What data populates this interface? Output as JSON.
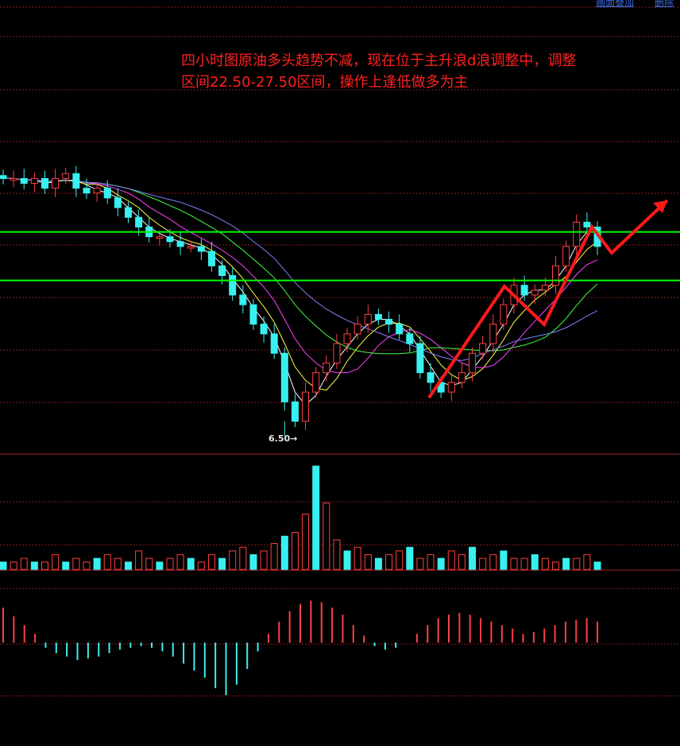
{
  "toolbar": {
    "link1": "画面叠加",
    "link2": "删除"
  },
  "annotation": {
    "text": "四小时图原油多头趋势不减，现在位于主升浪d浪调整中，调整区间22.50-27.50区间，操作上逢低做多为主"
  },
  "colors": {
    "background": "#000000",
    "grid": "#8b1a1a",
    "up_candle": "#ff4040",
    "down_candle": "#38f0f0",
    "support_lines": "#00ff00",
    "arrows": "#ff1a1a",
    "ma5": "#ffffff",
    "ma10": "#ffff40",
    "ma20": "#ff40ff",
    "ma40": "#40ff40",
    "ma60": "#8080ff"
  },
  "chart_data": {
    "type": "candlestick",
    "price": {
      "low_label": "6.50",
      "low_value": 6.5,
      "support_levels": [
        22.5,
        27.5
      ],
      "closes_trend": [
        33,
        33,
        32.5,
        33,
        32,
        33,
        33.5,
        32,
        31.5,
        32,
        31,
        30,
        29,
        28,
        27,
        27,
        26.5,
        26,
        26,
        25.5,
        24,
        23,
        21,
        20,
        18,
        17,
        15,
        10,
        8,
        11,
        13,
        14,
        16,
        17,
        18,
        19,
        18.5,
        18,
        17,
        16,
        13,
        12,
        11,
        12,
        13,
        15,
        16,
        18,
        20,
        22,
        21,
        21.5,
        22,
        24,
        26,
        28.5,
        28,
        26
      ],
      "moving_averages": [
        "MA5",
        "MA10",
        "MA20",
        "MA40",
        "MA60"
      ]
    },
    "volume": {
      "values": [
        2,
        2,
        3,
        2,
        2,
        4,
        2,
        3,
        2,
        3,
        4,
        3,
        2,
        5,
        3,
        2,
        3,
        4,
        3,
        2,
        4,
        3,
        5,
        6,
        4,
        5,
        7,
        9,
        10,
        15,
        28,
        18,
        8,
        5,
        6,
        4,
        3,
        4,
        5,
        6,
        3,
        4,
        3,
        5,
        4,
        6,
        3,
        4,
        5,
        3,
        3,
        4,
        3,
        2,
        3,
        3,
        4,
        2
      ]
    },
    "macd": {
      "hist": [
        2,
        1.5,
        1,
        0.5,
        -0.3,
        -0.6,
        -0.8,
        -1,
        -0.9,
        -0.8,
        -0.6,
        -0.4,
        -0.3,
        -0.2,
        -0.3,
        -0.5,
        -0.8,
        -1.2,
        -1.6,
        -2,
        -2.6,
        -3,
        -2.4,
        -1.5,
        -0.5,
        0.5,
        1.2,
        1.8,
        2.2,
        2.4,
        2.3,
        2,
        1.6,
        1,
        0.4,
        -0.2,
        -0.4,
        -0.3,
        0,
        0.5,
        1,
        1.4,
        1.6,
        1.7,
        1.6,
        1.4,
        1.2,
        1,
        0.8,
        0.5,
        0.6,
        0.8,
        1,
        1.2,
        1.3,
        1.4,
        1.2
      ]
    }
  }
}
